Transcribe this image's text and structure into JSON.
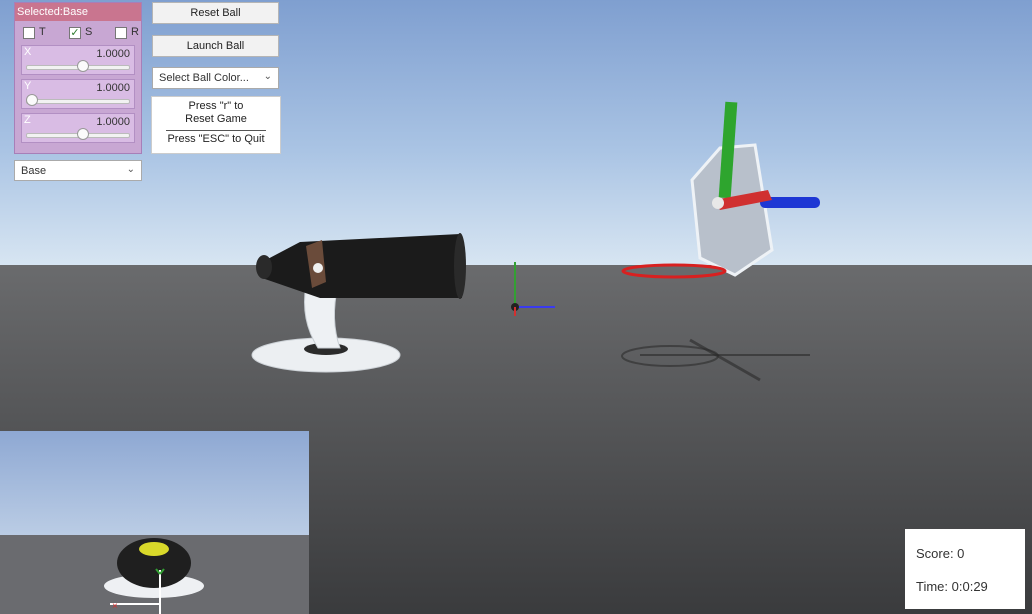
{
  "panel": {
    "title": "Selected:Base",
    "checkboxes": [
      {
        "label": "T",
        "checked": false
      },
      {
        "label": "S",
        "checked": true
      },
      {
        "label": "R",
        "checked": false
      }
    ],
    "sliders": [
      {
        "axis": "X",
        "value": "1.0000",
        "fraction": 0.5
      },
      {
        "axis": "Y",
        "value": "1.0000",
        "fraction": 0.02
      },
      {
        "axis": "Z",
        "value": "1.0000",
        "fraction": 0.5
      }
    ],
    "object_select": "Base"
  },
  "buttons": {
    "reset": "Reset Ball",
    "launch": "Launch Ball"
  },
  "color_select": "Select Ball Color...",
  "info": {
    "line1": "Press \"r\" to",
    "line2": "Reset Game",
    "line3": "Press \"ESC\" to Quit"
  },
  "status": {
    "score": "Score: 0",
    "time": "Time: 0:0:29"
  },
  "colors": {
    "panel_bg": "#c8a7d3",
    "panel_title": "#c9758f",
    "axis_x": "#d32f2f",
    "axis_y": "#2e9b2e",
    "axis_z": "#1f3ed6",
    "ring": "#e02020"
  }
}
